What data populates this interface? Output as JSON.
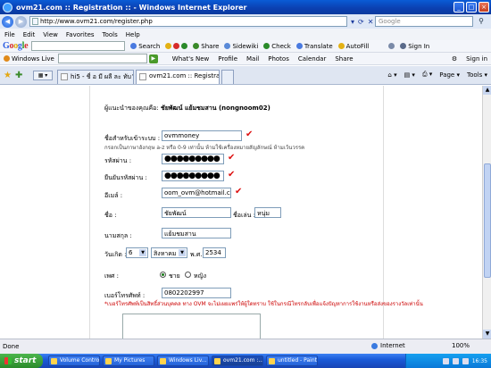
{
  "window": {
    "title": "ovm21.com :: Registration :: - Windows Internet Explorer"
  },
  "address": {
    "url": "http://www.ovm21.com/register.php",
    "search_placeholder": "Google"
  },
  "menu": [
    "File",
    "Edit",
    "View",
    "Favorites",
    "Tools",
    "Help"
  ],
  "google_bar": {
    "logo": "Google",
    "search_label": "Search",
    "share_label": "Share",
    "sidewiki_label": "Sidewiki",
    "check_label": "Check",
    "translate_label": "Translate",
    "autofill_label": "AutoFill",
    "signin_label": "Sign In"
  },
  "windows_live_bar": {
    "logo": "Windows Live",
    "links": [
      "What's New",
      "Profile",
      "Mail",
      "Photos",
      "Calendar",
      "Share"
    ],
    "signin_label": "Sign in"
  },
  "tabs": [
    {
      "label": "hi5 - ชื่ อ  มี ผลื  ละ ทับ™..."
    },
    {
      "label": "ovm21.com :: Registratio..."
    }
  ],
  "tab_tools": {
    "page_label": "Page",
    "tools_label": "Tools"
  },
  "form": {
    "greeting_prefix": "ผู้แนะนำของคุณคือ:",
    "greeting_name": "ชัยพัฒน์ แย้มชมสาน (nongnoom02)",
    "username_label": "ชื่อสำหรับเข้าระบบ :",
    "username_value": "ovmmoney",
    "username_hint": "กรอกเป็นภาษาอังกฤษ a-z หรือ 0-9 เท่านั้น ห้ามใช้เครื่องหมายสัญลักษณ์ ห้ามเว้นวรรค",
    "password_label": "รหัสผ่าน :",
    "password_value": "●●●●●●●●●",
    "confirm_label": "ยืนยันรหัสผ่าน :",
    "confirm_value": "●●●●●●●●●",
    "email_label": "อีเมล์ :",
    "email_value": "oom_ovm@hotmail.com",
    "name_label": "ชื่อ :",
    "name_value": "ชัยพัฒน์",
    "nickname_label": "ชื่อเล่น :",
    "nickname_value": "หนุ่ม",
    "surname_label": "นามสกุล :",
    "surname_value": "แย้มชมสาน",
    "birthday_label": "วันเกิด :",
    "birth_day": "6",
    "birth_month": "สิงหาคม",
    "birth_year_prefix": "พ.ศ.",
    "birth_year": "2534",
    "gender_label": "เพศ :",
    "gender_male": "ชาย",
    "gender_female": "หญิง",
    "phone_label": "เบอร์โทรศัพท์ :",
    "phone_value": "0802202997",
    "phone_note": "*เบอร์โทรศัพท์เป็นสิทธิ์ส่วนบุคคล ทาง OVM จะไม่เผยแพร่ให้ผู้ใดทราบ ใช้ในกรณีโทรกลับเพื่อแจ้งปัญหาการใช้งานหรือส่งของรางวัลเท่านั้น"
  },
  "status": {
    "left": "Done",
    "zone": "Internet",
    "zoom": "100%"
  },
  "taskbar": {
    "start": "start",
    "items": [
      "Volume Control",
      "My Pictures",
      "Windows Liv...",
      "ovm21.com :...",
      "untitled - Paint"
    ],
    "clock": "16:35"
  },
  "colors": {
    "check_mark": "#d11111",
    "note_red": "#cc0000",
    "title_bar": "#0b3fb0"
  }
}
